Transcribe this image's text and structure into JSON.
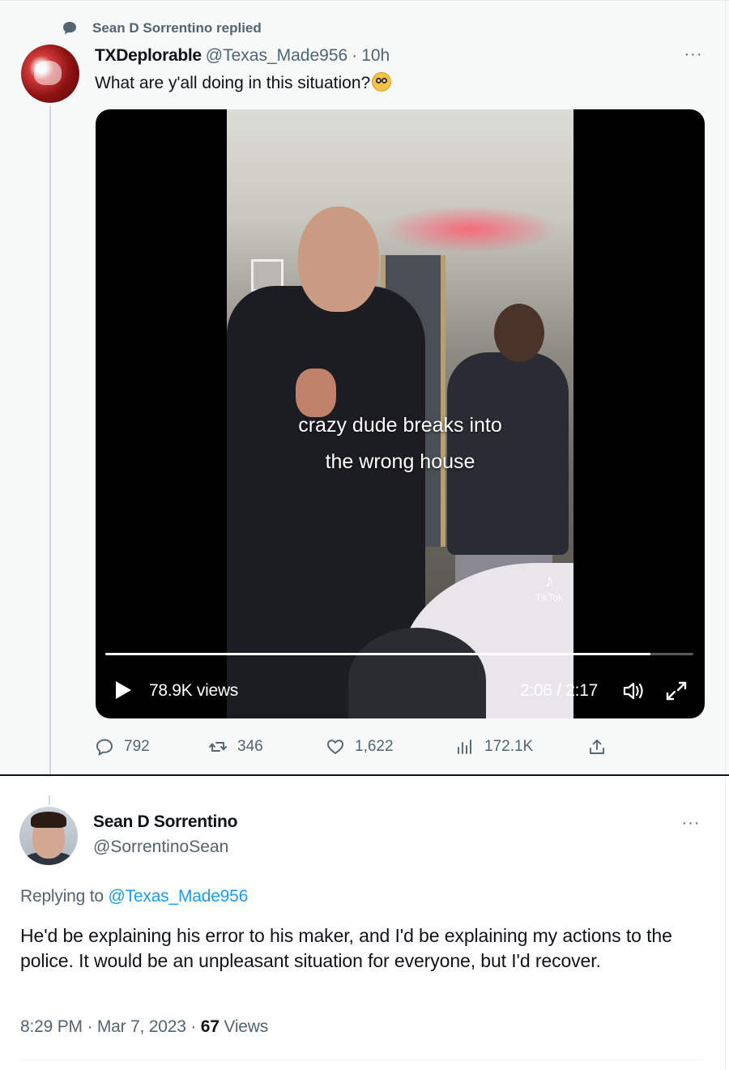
{
  "parent": {
    "social_context": "Sean D Sorrentino replied",
    "author_name": "TXDeplorable",
    "author_handle": "@Texas_Made956",
    "separator": "·",
    "time_ago": "10h",
    "text": "What are y'all doing in this situation?",
    "emoji": "flushed-face-emoji",
    "more_label": "···",
    "video": {
      "caption_line1": "crazy dude breaks into",
      "caption_line2": "the wrong house",
      "watermark": "TikTok",
      "views": "78.9K views",
      "time": "2:06 / 2:17",
      "progress_fraction": 0.927
    },
    "actions": {
      "replies": "792",
      "retweets": "346",
      "likes": "1,622",
      "views": "172.1K"
    },
    "icons": {
      "social_context": "speech-bubble-icon",
      "reply": "reply-icon",
      "retweet": "retweet-icon",
      "like": "heart-icon",
      "views": "analytics-icon",
      "share": "share-icon",
      "play": "play-icon",
      "volume": "volume-icon",
      "fullscreen": "fullscreen-icon"
    }
  },
  "reply": {
    "author_name": "Sean D Sorrentino",
    "author_handle": "@SorrentinoSean",
    "more_label": "···",
    "replying_prefix": "Replying to ",
    "replying_handle": "@Texas_Made956",
    "body": "He'd be explaining his error to his maker, and I'd be explaining my actions to the police. It would be an unpleasant situation for everyone, but I'd recover.",
    "timestamp": "8:29 PM · Mar 7, 2023 · ",
    "views_count": "67",
    "views_label": " Views"
  },
  "colors": {
    "text": "#0f1419",
    "secondary": "#536471",
    "link": "#1d9bf0",
    "panel_bg": "#f7f9f9"
  }
}
